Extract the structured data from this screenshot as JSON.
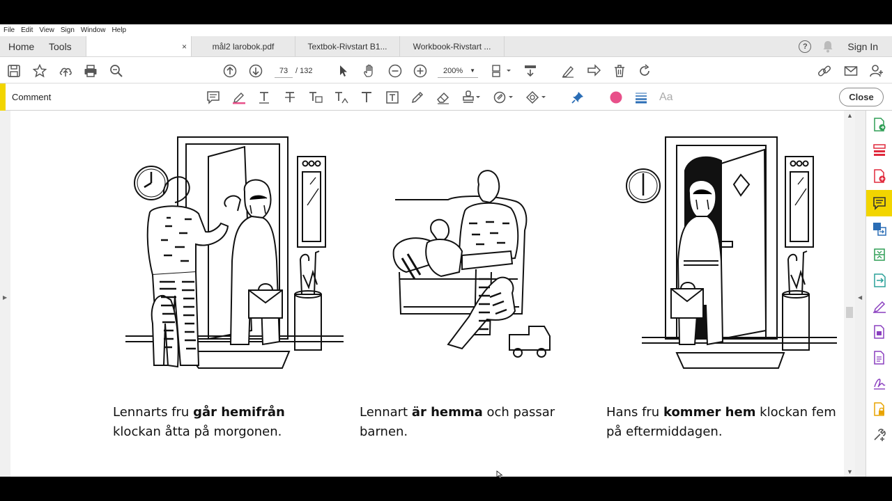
{
  "menu": [
    "File",
    "Edit",
    "View",
    "Sign",
    "Window",
    "Help"
  ],
  "tabs": {
    "home": "Home",
    "tools": "Tools",
    "close_glyph": "×",
    "documents": [
      "mål2 larobok.pdf",
      "Textbok-Rivstart B1...",
      "Workbook-Rivstart ..."
    ]
  },
  "header_right": {
    "help": "?",
    "sign_in": "Sign In"
  },
  "toolbar": {
    "page_current": "73",
    "page_total": "/ 132",
    "zoom": "200%",
    "zoom_caret": "▼"
  },
  "comment_bar": {
    "label": "Comment",
    "close_label": "Close",
    "color_dot": "#e8508a",
    "text_tool_glyph": "Aa"
  },
  "scroll": {
    "up": "▲",
    "down": "▼",
    "left_panel_arrow": "▶",
    "right_panel_arrow": "◀"
  },
  "captions": [
    {
      "pre": "Lennarts fru ",
      "bold": "går hemifrån",
      "post": "",
      "line2": "klockan åtta på morgonen."
    },
    {
      "pre": "Lennart ",
      "bold": "är hemma",
      "post": " och passar",
      "line2": "barnen."
    },
    {
      "pre": "Hans fru ",
      "bold": "kommer hem",
      "post": " klockan fem",
      "line2": "på eftermiddagen."
    }
  ],
  "colors": {
    "accent_yellow": "#f2d500",
    "adobe_red": "#e0283b",
    "tool_blue": "#2a6db5",
    "tool_green": "#2e9e55",
    "tool_purple": "#8a3fbf",
    "tool_orange": "#e8a400"
  }
}
